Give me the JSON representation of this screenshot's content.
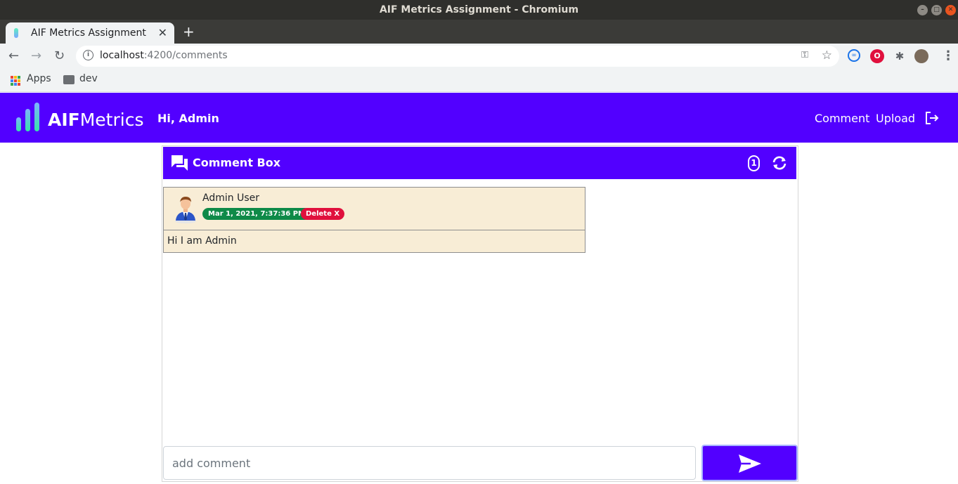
{
  "window": {
    "title": "AIF Metrics Assignment - Chromium"
  },
  "browser": {
    "tab_title": "AIF Metrics Assignment",
    "tab_close": "✕",
    "new_tab": "+",
    "url_host": "localhost",
    "url_path": ":4200/comments",
    "bookmarks": [
      {
        "label": "Apps",
        "icon": "apps-grid-icon"
      },
      {
        "label": "dev",
        "icon": "folder-icon"
      }
    ]
  },
  "app": {
    "logo_bold": "AIF",
    "logo_light": "Metrics",
    "greeting": "Hi, Admin",
    "nav": [
      {
        "label": "Comment"
      },
      {
        "label": "Upload"
      }
    ],
    "brand_color": "#5200ff"
  },
  "comment_box": {
    "title": "Comment Box",
    "count": "1",
    "comments": [
      {
        "author": "Admin User",
        "timestamp": "Mar 1, 2021, 7:37:36 PM",
        "delete_label": "Delete X",
        "text": "Hi I am Admin"
      }
    ],
    "input_placeholder": "add comment",
    "input_value": ""
  },
  "colors": {
    "card_bg": "#f8edd6",
    "date_badge": "#0e8a48",
    "delete_badge": "#e0103d"
  }
}
